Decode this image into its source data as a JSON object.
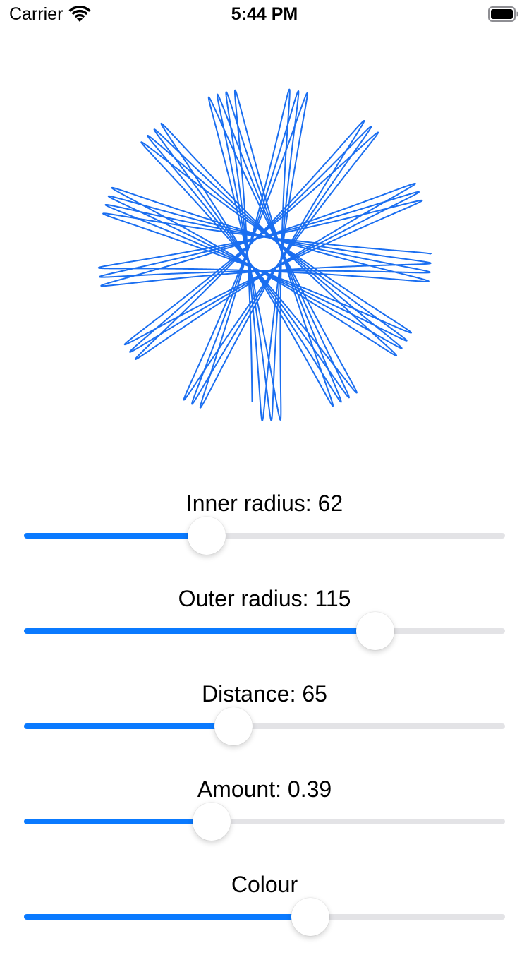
{
  "status_bar": {
    "carrier": "Carrier",
    "time": "5:44 PM",
    "wifi_icon": "wifi-icon",
    "battery_icon": "battery-icon"
  },
  "spirograph": {
    "inner_radius": 62,
    "outer_radius": 115,
    "distance": 65,
    "amount": 0.39,
    "stroke_color": "#1a6ef0"
  },
  "sliders": [
    {
      "label": "Inner radius: 62",
      "value": 0.38
    },
    {
      "label": "Outer radius: 115",
      "value": 0.73
    },
    {
      "label": "Distance: 65",
      "value": 0.435
    },
    {
      "label": "Amount: 0.39",
      "value": 0.39
    },
    {
      "label": "Colour",
      "value": 0.595
    }
  ],
  "colors": {
    "accent": "#0a7aff",
    "track": "#e3e3e6"
  }
}
